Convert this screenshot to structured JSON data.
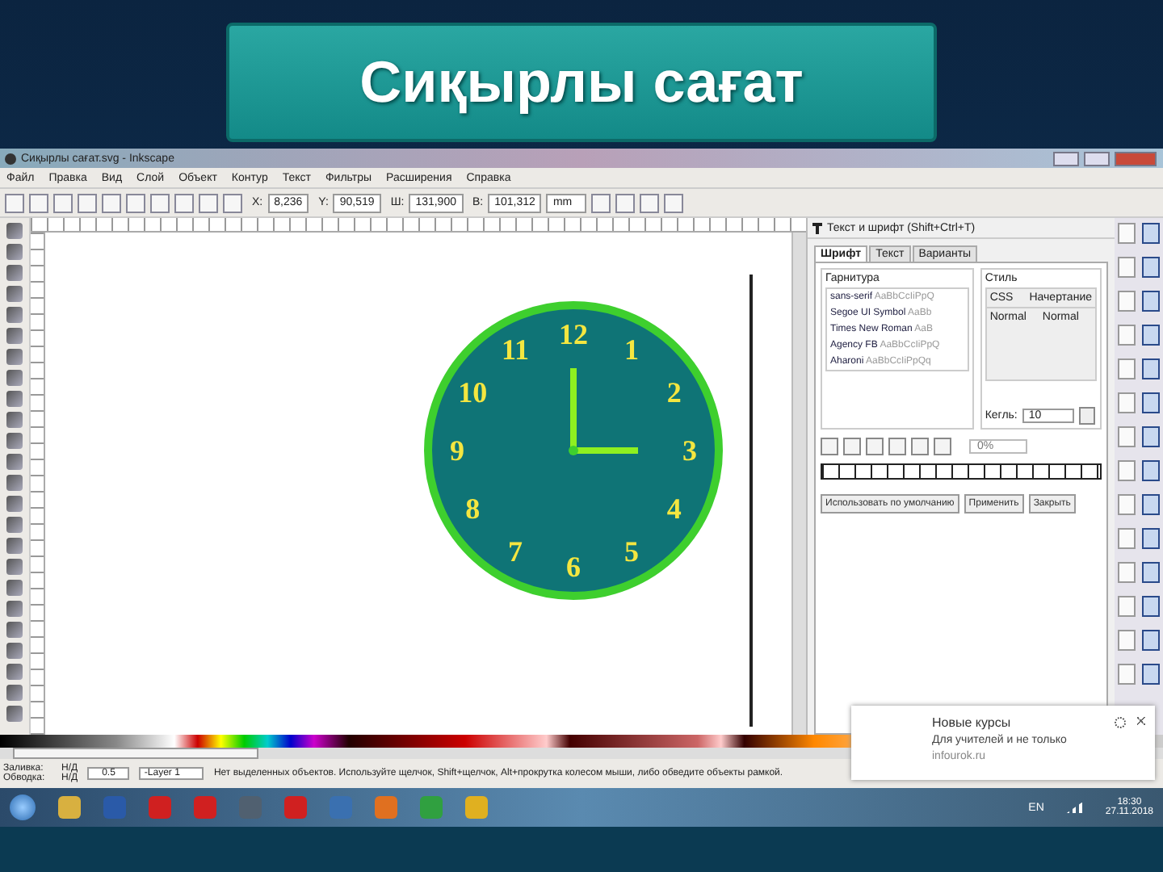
{
  "slide_title": "Сиқырлы сағат",
  "window": {
    "title": "Сиқырлы сағат.svg - Inkscape"
  },
  "menu": [
    "Файл",
    "Правка",
    "Вид",
    "Слой",
    "Объект",
    "Контур",
    "Текст",
    "Фильтры",
    "Расширения",
    "Справка"
  ],
  "toolbar_fields": [
    {
      "label": "X:",
      "value": "8,236"
    },
    {
      "label": "Y:",
      "value": "90,519"
    },
    {
      "label": "Ш:",
      "value": "131,900"
    },
    {
      "label": "В:",
      "value": "101,312"
    }
  ],
  "unit": "mm",
  "clock": {
    "numerals": [
      "12",
      "1",
      "2",
      "3",
      "4",
      "5",
      "6",
      "7",
      "8",
      "9",
      "10",
      "11"
    ]
  },
  "text_dialog": {
    "title": "Текст и шрифт (Shift+Ctrl+T)",
    "tabs": [
      {
        "label": "Шрифт",
        "selected": true
      },
      {
        "label": "Текст",
        "selected": false
      },
      {
        "label": "Варианты",
        "selected": false
      }
    ],
    "family_label": "Гарнитура",
    "fonts": [
      {
        "name": "sans-serif",
        "sample": "AaBbCcIiPpQ"
      },
      {
        "name": "Segoe UI Symbol",
        "sample": "AaBb"
      },
      {
        "name": "Times New Roman",
        "sample": "AaB"
      },
      {
        "name": "Agency FB",
        "sample": "AaBbCcIiPpQ"
      },
      {
        "name": "Aharoni",
        "sample": "AaBbCcIiPpQq"
      }
    ],
    "style_label": "Стиль",
    "style_columns": [
      "CSS",
      "Начертание"
    ],
    "style_row": [
      "Normal",
      "Normal"
    ],
    "size_label": "Кегль:",
    "size_value": "10",
    "spacing_value": "0%",
    "buttons": [
      "Использовать по умолчанию",
      "Применить",
      "Закрыть"
    ]
  },
  "status_bar": {
    "fill_label": "Заливка:",
    "fill_value": "Н/Д",
    "stroke_label": "Обводка:",
    "stroke_value": "Н/Д",
    "opacity": "0.5",
    "layer": "-Layer 1",
    "message": "Нет выделенных объектов. Используйте щелчок, Shift+щелчок, Alt+прокрутка колесом мыши, либо обведите объекты рамкой."
  },
  "notification": {
    "title": "Новые курсы",
    "text": "Для учителей и не только",
    "source": "infourok.ru"
  },
  "taskbar": {
    "language": "EN",
    "time": "18:30",
    "date": "27.11.2018"
  }
}
